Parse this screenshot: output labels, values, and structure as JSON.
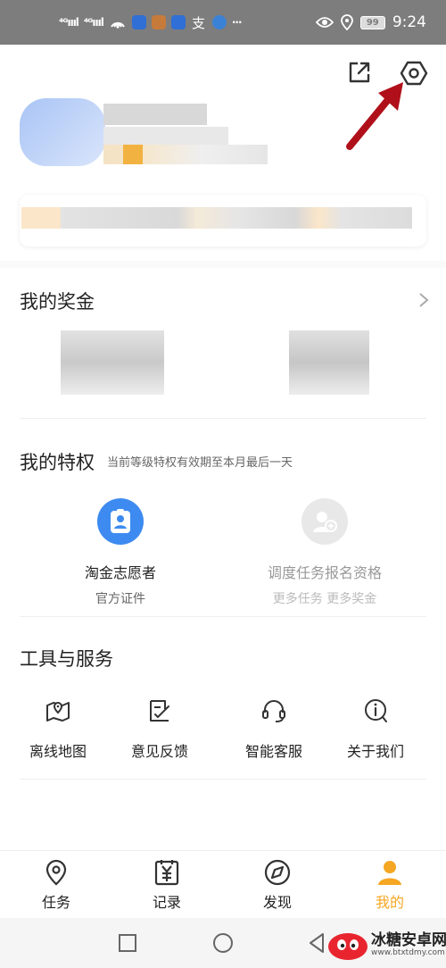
{
  "status_bar": {
    "signal1": "⁴ᴳıııl",
    "signal2": "⁴ᴳıııl",
    "battery": "99",
    "time": "9:24",
    "more": "···"
  },
  "rewards": {
    "title": "我的奖金"
  },
  "privileges": {
    "title": "我的特权",
    "subtitle": "当前等级特权有效期至本月最后一天",
    "items": [
      {
        "title": "淘金志愿者",
        "subtitle": "官方证件",
        "icon": "id-card-icon",
        "color": "#3d8bf0"
      },
      {
        "title": "调度任务报名资格",
        "subtitle": "更多任务 更多奖金",
        "icon": "add-user-icon",
        "color": "#e6e6e6"
      }
    ]
  },
  "tools": {
    "title": "工具与服务",
    "items": [
      {
        "label": "离线地图",
        "icon": "map-pin-icon"
      },
      {
        "label": "意见反馈",
        "icon": "feedback-icon"
      },
      {
        "label": "智能客服",
        "icon": "headset-icon"
      },
      {
        "label": "关于我们",
        "icon": "info-icon"
      }
    ]
  },
  "bottom_nav": {
    "items": [
      {
        "label": "任务",
        "icon": "location-icon",
        "active": false
      },
      {
        "label": "记录",
        "icon": "ledger-icon",
        "active": false
      },
      {
        "label": "发现",
        "icon": "compass-icon",
        "active": false
      },
      {
        "label": "我的",
        "icon": "person-icon",
        "active": true
      }
    ],
    "active_color": "#f5a623"
  },
  "watermark": {
    "text": "冰糖安卓网",
    "url": "www.btxtdmy.com"
  }
}
